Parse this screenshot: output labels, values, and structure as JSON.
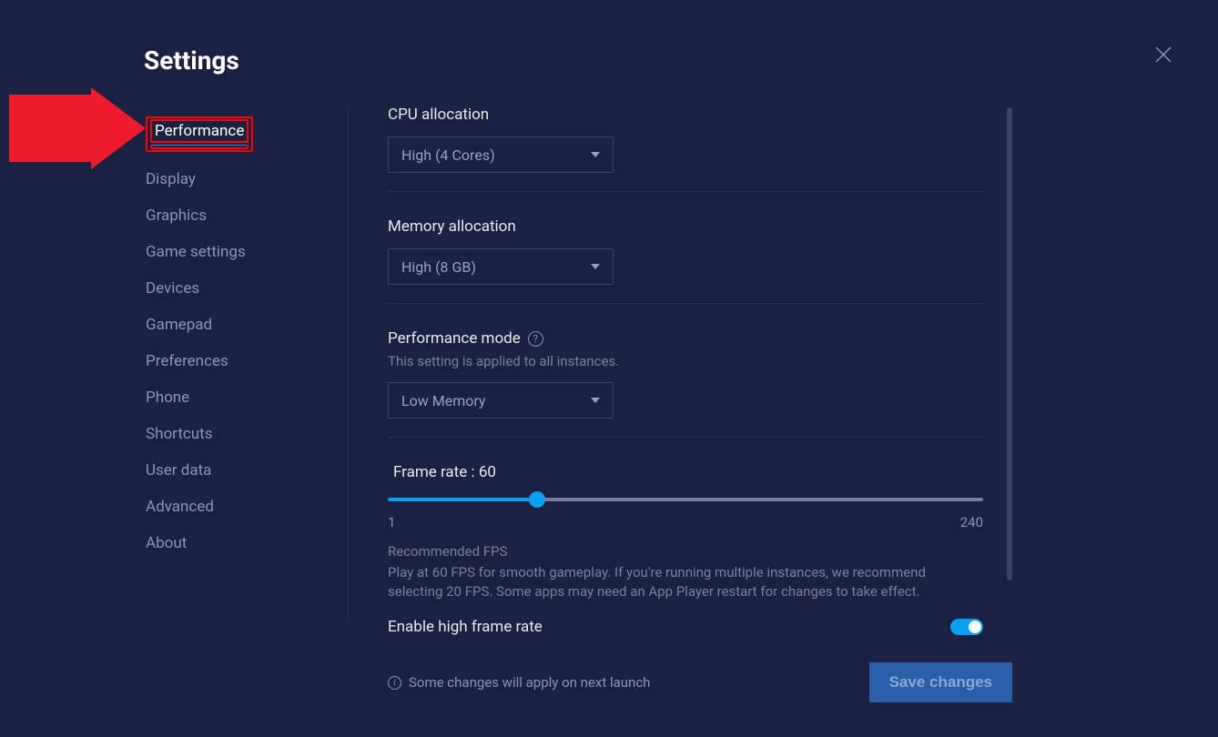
{
  "header": {
    "title": "Settings"
  },
  "sidebar": {
    "items": [
      {
        "label": "Performance",
        "active": true
      },
      {
        "label": "Display"
      },
      {
        "label": "Graphics"
      },
      {
        "label": "Game settings"
      },
      {
        "label": "Devices"
      },
      {
        "label": "Gamepad"
      },
      {
        "label": "Preferences"
      },
      {
        "label": "Phone"
      },
      {
        "label": "Shortcuts"
      },
      {
        "label": "User data"
      },
      {
        "label": "Advanced"
      },
      {
        "label": "About"
      }
    ]
  },
  "content": {
    "cpu": {
      "label": "CPU allocation",
      "value": "High (4 Cores)"
    },
    "memory": {
      "label": "Memory allocation",
      "value": "High (8 GB)"
    },
    "perfmode": {
      "label": "Performance mode",
      "sub": "This setting is applied to all instances.",
      "value": "Low Memory"
    },
    "framerate": {
      "label_prefix": "Frame rate : ",
      "value": "60",
      "min": "1",
      "max": "240",
      "percent": 25,
      "rec_title": "Recommended FPS",
      "rec_body": "Play at 60 FPS for smooth gameplay. If you're running multiple instances, we recommend selecting 20 FPS. Some apps may need an App Player restart for changes to take effect."
    },
    "high_fps": {
      "label": "Enable high frame rate",
      "on": true
    }
  },
  "footer": {
    "note": "Some changes will apply on next launch",
    "save": "Save changes"
  }
}
